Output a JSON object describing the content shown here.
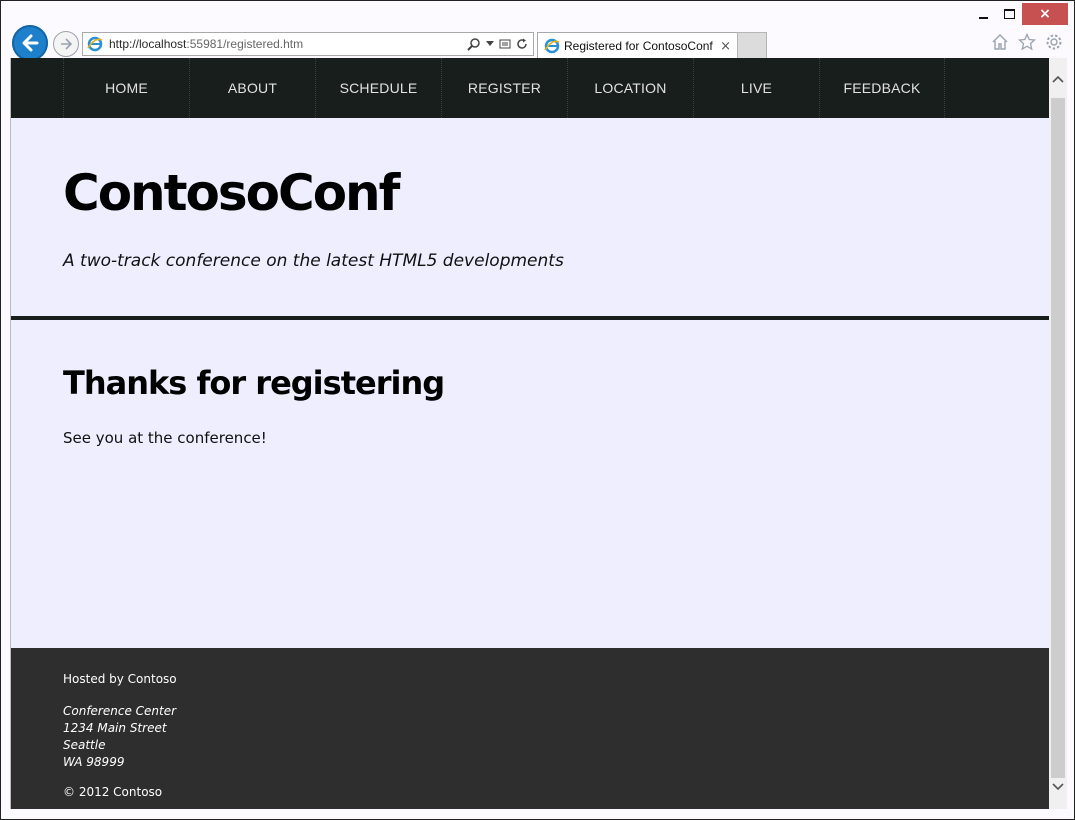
{
  "browser": {
    "url_prefix": "http://localhost",
    "url_rest": ":55981/registered.htm",
    "tab_title": "Registered for ContosoConf",
    "tab_close": "×",
    "window_close": "×"
  },
  "nav": {
    "items": [
      "HOME",
      "ABOUT",
      "SCHEDULE",
      "REGISTER",
      "LOCATION",
      "LIVE",
      "FEEDBACK"
    ]
  },
  "header": {
    "title": "ContosoConf",
    "tagline": "A two-track conference on the latest HTML5 developments"
  },
  "main": {
    "heading": "Thanks for registering",
    "message": "See you at the conference!"
  },
  "footer": {
    "hosted": "Hosted by Contoso",
    "address": [
      "Conference Center",
      "1234 Main Street",
      "Seattle",
      "WA 98999"
    ],
    "copyright": "© 2012 Contoso"
  },
  "colors": {
    "page_bg": "#eeeeff",
    "nav_bg": "#181e1c",
    "footer_bg": "#2e2e2e",
    "back_button": "#1e7fcb",
    "close_button": "#c75050"
  },
  "icons": [
    "back-arrow-icon",
    "forward-arrow-icon",
    "ie-favicon-icon",
    "search-icon",
    "compat-view-icon",
    "refresh-icon",
    "home-icon",
    "favorites-star-icon",
    "settings-gear-icon"
  ]
}
